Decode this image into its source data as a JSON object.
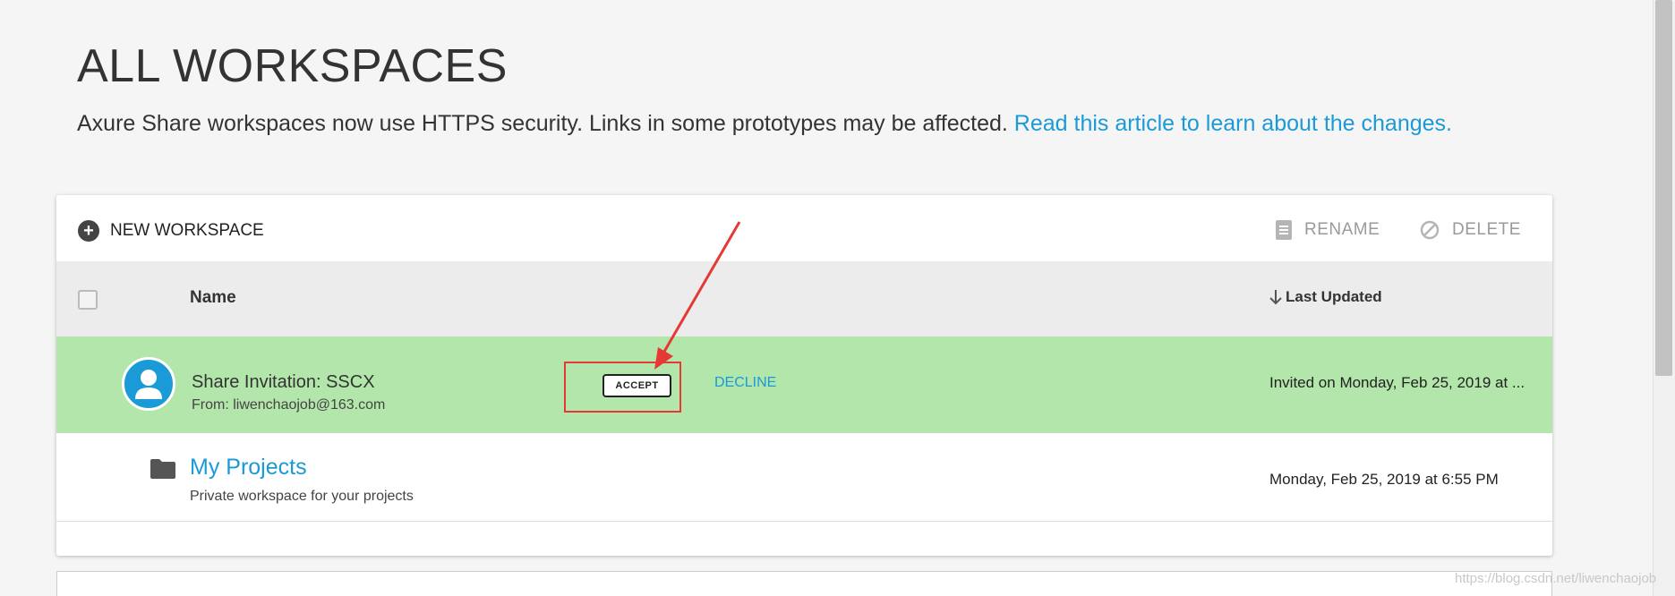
{
  "page": {
    "title": "ALL WORKSPACES",
    "notice_text": "Axure Share workspaces now use HTTPS security. Links in some prototypes may be affected.",
    "notice_link": "Read this article to learn about the changes."
  },
  "toolbar": {
    "new_workspace": "NEW WORKSPACE",
    "rename": "RENAME",
    "delete": "DELETE"
  },
  "table": {
    "col_name": "Name",
    "col_updated": "Last Updated"
  },
  "invitation": {
    "title": "Share Invitation: SSCX",
    "from": "From: liwenchaojob@163.com",
    "accept": "ACCEPT",
    "decline": "DECLINE",
    "date": "Invited on Monday, Feb 25, 2019 at ..."
  },
  "workspace": {
    "name": "My Projects",
    "description": "Private workspace for your projects",
    "date": "Monday, Feb 25, 2019 at 6:55 PM"
  },
  "watermark": "https://blog.csdn.net/liwenchaojob",
  "colors": {
    "accent": "#1a9ad6",
    "invite_row_bg": "#b3e6aa",
    "highlight": "#e53935"
  }
}
